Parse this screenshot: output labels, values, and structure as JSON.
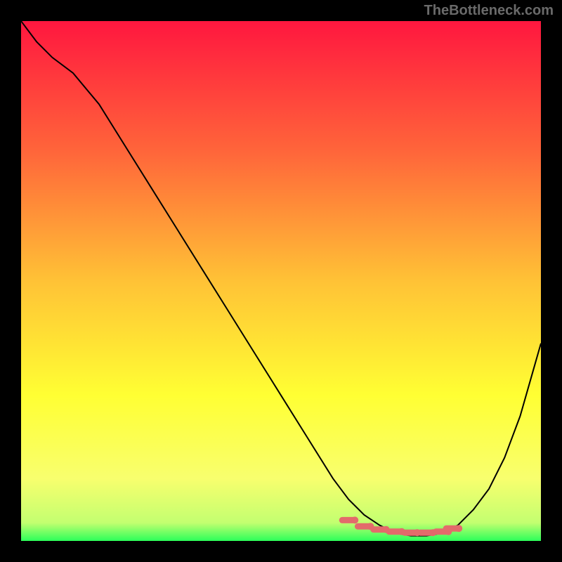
{
  "watermark": "TheBottleneck.com",
  "chart_data": {
    "type": "line",
    "title": "",
    "xlabel": "",
    "ylabel": "",
    "xlim": [
      0,
      100
    ],
    "ylim": [
      0,
      100
    ],
    "grid": false,
    "legend": false,
    "background_gradient": {
      "stops": [
        {
          "offset": 0.0,
          "color": "#ff173f"
        },
        {
          "offset": 0.25,
          "color": "#ff653a"
        },
        {
          "offset": 0.5,
          "color": "#ffc236"
        },
        {
          "offset": 0.72,
          "color": "#ffff33"
        },
        {
          "offset": 0.88,
          "color": "#f8ff6e"
        },
        {
          "offset": 0.965,
          "color": "#c3ff70"
        },
        {
          "offset": 1.0,
          "color": "#2bff5a"
        }
      ]
    },
    "series": [
      {
        "name": "bottleneck-curve",
        "color": "#000000",
        "x": [
          0,
          3,
          6,
          10,
          15,
          20,
          25,
          30,
          35,
          40,
          45,
          50,
          55,
          60,
          63,
          66,
          69,
          72,
          75,
          78,
          81,
          84,
          87,
          90,
          93,
          96,
          100
        ],
        "y": [
          100,
          96,
          93,
          90,
          84,
          76,
          68,
          60,
          52,
          44,
          36,
          28,
          20,
          12,
          8,
          5,
          3,
          1.5,
          1,
          1,
          1.5,
          3,
          6,
          10,
          16,
          24,
          38
        ]
      }
    ],
    "marker_band": {
      "name": "optimal-range",
      "color": "#e36b6b",
      "x": [
        63,
        66,
        69,
        72,
        75,
        78,
        81,
        83
      ],
      "y": [
        4.0,
        2.8,
        2.2,
        1.8,
        1.6,
        1.6,
        1.8,
        2.4
      ]
    }
  }
}
